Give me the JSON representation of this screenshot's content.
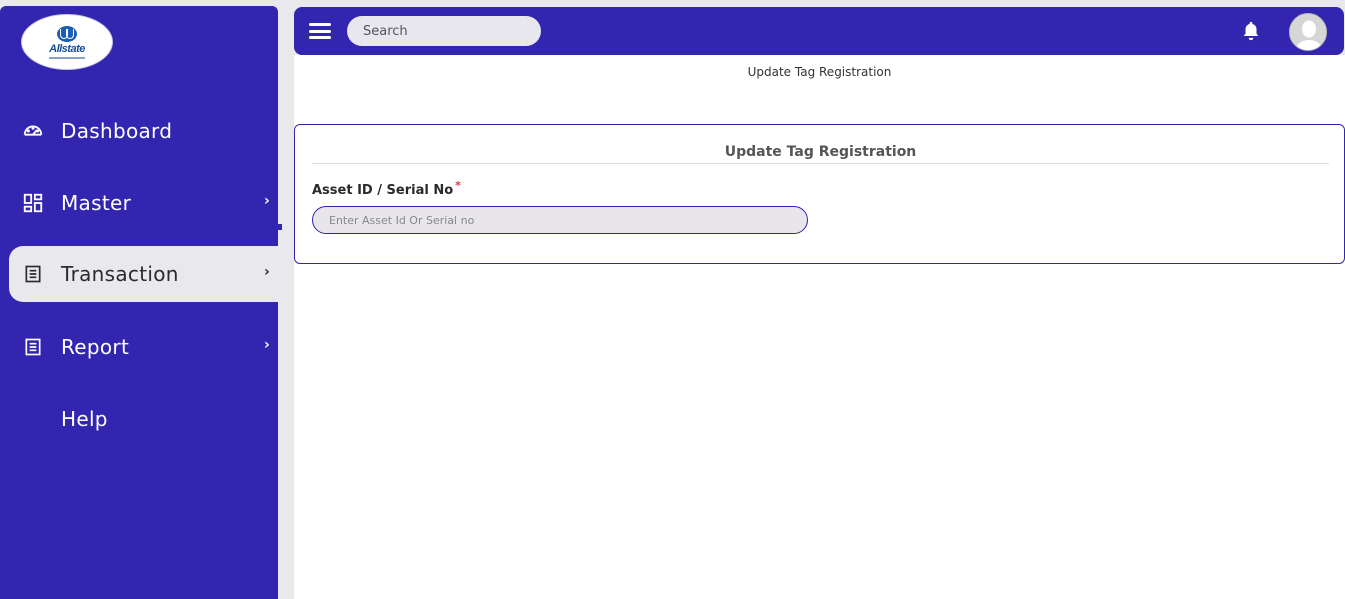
{
  "brand": {
    "logo_text": "Allstate"
  },
  "sidebar": {
    "items": [
      {
        "label": "Dashboard",
        "icon": "speedometer-icon",
        "chevron": ""
      },
      {
        "label": "Master",
        "icon": "grid-icon",
        "chevron": "›"
      },
      {
        "label": "Transaction",
        "icon": "receipt-icon",
        "chevron": "›",
        "active": true
      },
      {
        "label": "Report",
        "icon": "report-icon",
        "chevron": "›"
      },
      {
        "label": "Help",
        "icon": "",
        "chevron": ""
      }
    ]
  },
  "topbar": {
    "search_placeholder": "Search",
    "notification_icon": "bell-icon",
    "avatar_icon": "user-avatar-icon"
  },
  "page": {
    "breadcrumb_title": "Update Tag Registration"
  },
  "form": {
    "title": "Update Tag Registration",
    "field_label": "Asset ID / Serial No",
    "required_mark": "*",
    "field_placeholder": "Enter Asset Id Or Serial no",
    "field_value": ""
  },
  "colors": {
    "primary": "#3226b0",
    "background": "#e9e8ec",
    "required": "#e0303a"
  }
}
